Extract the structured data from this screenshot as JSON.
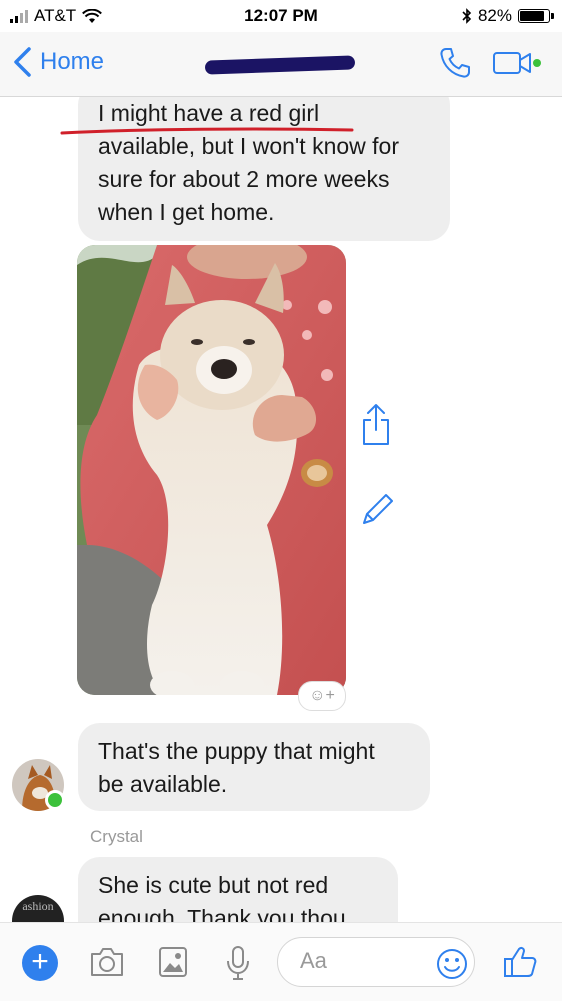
{
  "status_bar": {
    "carrier": "AT&T",
    "time": "12:07 PM",
    "battery": "82%",
    "battery_level": 0.82,
    "icons": [
      "signal-bars-icon",
      "wifi-icon",
      "bluetooth-icon",
      "battery-icon"
    ]
  },
  "header": {
    "back_label": "Home",
    "contact_name_redacted": true,
    "icons": [
      "chevron-left-icon",
      "phone-icon",
      "video-call-icon"
    ]
  },
  "messages": [
    {
      "type": "text",
      "lines": [
        "I might have a red girl",
        "available, but I won't know for",
        "sure for about 2 more weeks",
        "when I get home."
      ]
    },
    {
      "type": "image",
      "alt_icon": "puppy-photo"
    },
    {
      "type": "text",
      "lines": [
        "That's the puppy that might",
        "be available."
      ]
    },
    {
      "type": "text",
      "lines": [
        "She is cute but not red",
        "enough.  Thank you thou"
      ]
    }
  ],
  "sender_label": "Crystal",
  "avatar2_text": "ashion",
  "composer": {
    "placeholder": "Aa",
    "icons": [
      "plus-icon",
      "camera-icon",
      "image-icon",
      "microphone-icon",
      "emoji-icon",
      "thumbs-up-icon"
    ]
  },
  "colors": {
    "accent": "#2f80ed",
    "bubble": "#eeeeee",
    "online": "#3cc13b",
    "annotation_underline": "#d0202a"
  }
}
